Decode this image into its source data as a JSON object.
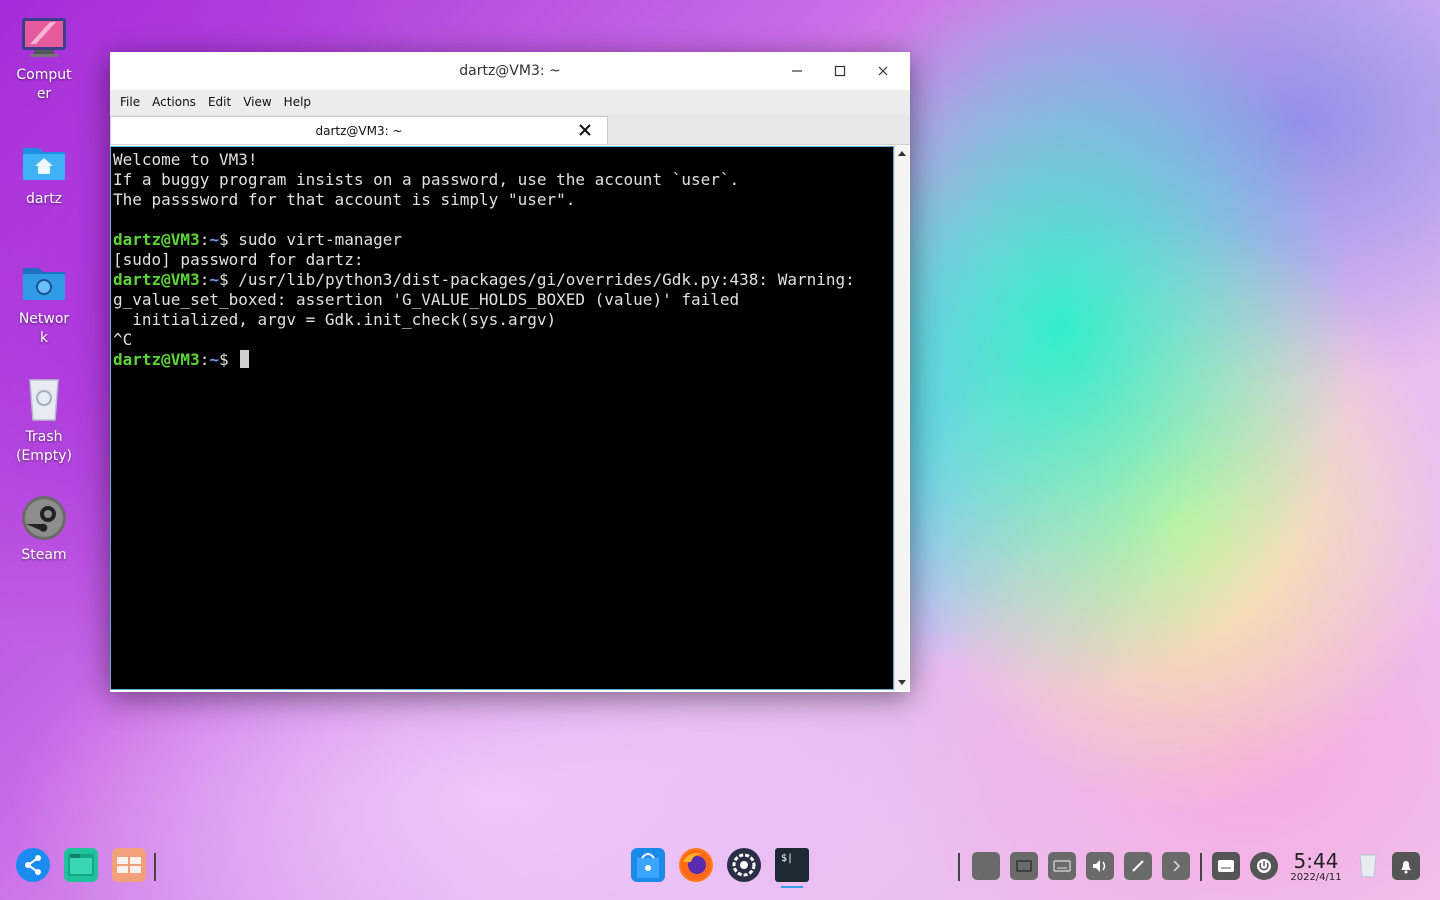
{
  "desktop": {
    "icons": [
      {
        "label": "Comput\ner"
      },
      {
        "label": "dartz"
      },
      {
        "label": "Networ\nk"
      },
      {
        "label": "Trash\n(Empty)"
      },
      {
        "label": "Steam"
      }
    ]
  },
  "window": {
    "title": "dartz@VM3: ~",
    "menu": [
      "File",
      "Actions",
      "Edit",
      "View",
      "Help"
    ],
    "tab_title": "dartz@VM3: ~"
  },
  "terminal": {
    "lines": [
      "Welcome to VM3!",
      "If a buggy program insists on a password, use the account `user`.",
      "The passsword for that account is simply \"user\".",
      ""
    ],
    "prompt_user": "dartz@VM3",
    "prompt_path": "~",
    "prompt_sep": ":",
    "prompt_end": "$ ",
    "cmd1": "sudo virt-manager",
    "sudo_line": "[sudo] password for dartz:",
    "warn1": "/usr/lib/python3/dist-packages/gi/overrides/Gdk.py:438: Warning:",
    "warn2": "g_value_set_boxed: assertion 'G_VALUE_HOLDS_BOXED (value)' failed",
    "warn3": "  initialized, argv = Gdk.init_check(sys.argv)",
    "ctrl_c": "^C"
  },
  "taskbar": {
    "time": "5:44",
    "date": "2022/4/11"
  },
  "colors": {
    "prompt_user": "#5bd636",
    "prompt_path": "#6b9ae8",
    "terminal_bg": "#000000"
  }
}
